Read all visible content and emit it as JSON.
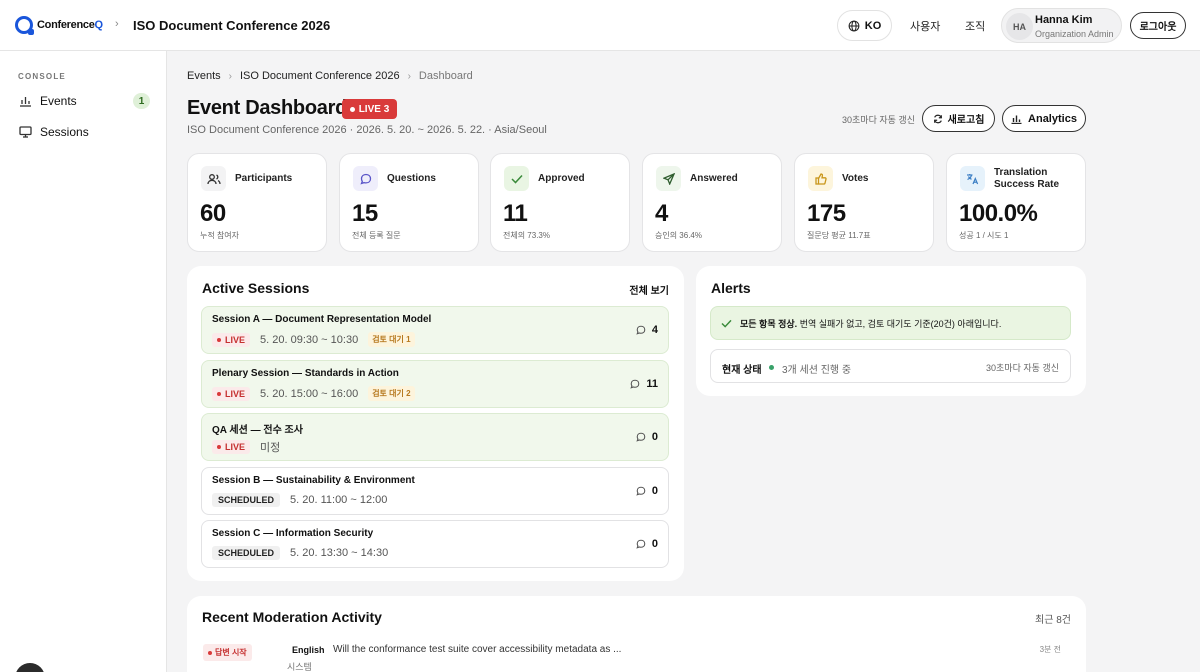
{
  "app": {
    "logo_prefix": "Conference",
    "logo_suffix": "Q",
    "event_title": "ISO Document Conference 2026"
  },
  "topnav": {
    "lang": "KO",
    "users": "사용자",
    "org": "조직",
    "user_initials": "HA",
    "user_name": "Hanna Kim",
    "user_role": "Organization Admin",
    "logout": "로그아웃"
  },
  "sidebar": {
    "section": "CONSOLE",
    "items": [
      {
        "label": "Events",
        "badge": "1"
      },
      {
        "label": "Sessions"
      }
    ]
  },
  "breadcrumb": [
    "Events",
    "ISO Document Conference 2026",
    "Dashboard"
  ],
  "header": {
    "title": "Event Dashboard",
    "live": "LIVE 3",
    "subtitle": "ISO Document Conference 2026 · 2026. 5. 20. ~ 2026. 5. 22. · Asia/Seoul",
    "auto_refresh": "30초마다 자동 갱신",
    "refresh": "새로고침",
    "analytics": "Analytics"
  },
  "stats": [
    {
      "label": "Participants",
      "value": "60",
      "sub": "누적 참여자",
      "icon": "participants-icon"
    },
    {
      "label": "Questions",
      "value": "15",
      "sub": "전체 등록 질문",
      "icon": "questions-icon"
    },
    {
      "label": "Approved",
      "value": "11",
      "sub": "전체의 73.3%",
      "icon": "approved-icon"
    },
    {
      "label": "Answered",
      "value": "4",
      "sub": "승인의 36.4%",
      "icon": "answered-icon"
    },
    {
      "label": "Votes",
      "value": "175",
      "sub": "질문당 평균 11.7표",
      "icon": "votes-icon"
    },
    {
      "label": "Translation Success Rate",
      "value": "100.0%",
      "sub": "성공 1 / 시도 1",
      "icon": "translation-icon"
    }
  ],
  "sessions": {
    "title": "Active Sessions",
    "view_all": "전체 보기",
    "items": [
      {
        "name": "Session A — Document Representation Model",
        "status": "LIVE",
        "time": "5. 20. 09:30 ~ 10:30",
        "review": "검토 대기 1",
        "count": "4"
      },
      {
        "name": "Plenary Session — Standards in Action",
        "status": "LIVE",
        "time": "5. 20. 15:00 ~ 16:00",
        "review": "검토 대기 2",
        "count": "11"
      },
      {
        "name": "QA 세션 — 전수 조사",
        "status": "LIVE",
        "time": "미정",
        "review": "",
        "count": "0"
      },
      {
        "name": "Session B — Sustainability & Environment",
        "status": "SCHEDULED",
        "time": "5. 20. 11:00 ~ 12:00",
        "review": "",
        "count": "0"
      },
      {
        "name": "Session C — Information Security",
        "status": "SCHEDULED",
        "time": "5. 20. 13:30 ~ 14:30",
        "review": "",
        "count": "0"
      }
    ]
  },
  "alerts": {
    "title": "Alerts",
    "ok_strong": "모든 항목 정상.",
    "ok_text": "번역 실패가 없고, 검토 대기도 기준(20건) 아래입니다.",
    "status_key": "현재 상태",
    "status_value": "3개 세션 진행 중",
    "status_refresh": "30초마다 자동 갱신"
  },
  "moderation": {
    "title": "Recent Moderation Activity",
    "count": "최근 8건",
    "rows": [
      {
        "tag": "답변 시작",
        "lang": "English",
        "text": "Will the conformance test suite cover accessibility metadata as ...",
        "actor": "시스템",
        "time": "3분 전"
      }
    ]
  },
  "colors": {
    "brand": "#1a56db",
    "live": "#d93a3a",
    "ok": "#38a169"
  }
}
